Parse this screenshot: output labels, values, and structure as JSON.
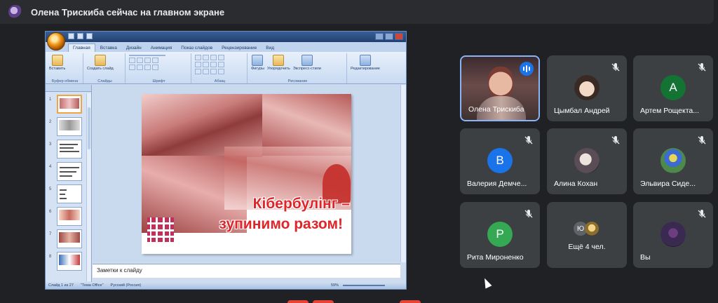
{
  "banner": {
    "text": "Олена Трискиба сейчас на главном экране"
  },
  "presentation": {
    "app_tabs": [
      "Главная",
      "Вставка",
      "Дизайн",
      "Анимация",
      "Показ слайдов",
      "Рецензирование",
      "Вид"
    ],
    "active_tab": "Главная",
    "ribbon_groups": {
      "clipboard": "Буфер обмена",
      "slides": "Слайды",
      "font": "Шрифт",
      "paragraph": "Абзац",
      "drawing": "Рисование",
      "editing": "Редактирование"
    },
    "ribbon_buttons": {
      "paste": "Вставить",
      "new_slide": "Создать слайд",
      "shapes": "Фигуры",
      "arrange": "Упорядочить",
      "quick_styles": "Экспресс-стили"
    },
    "thumbnails": [
      "1",
      "2",
      "3",
      "4",
      "5",
      "6",
      "7",
      "8"
    ],
    "slide": {
      "title_line1": "Кібербулінг –",
      "title_line2": "зупинимо разом!"
    },
    "notes_placeholder": "Заметки к слайду",
    "status": {
      "slide_counter": "Слайд 1 из 27",
      "theme": "\"Тема Office\"",
      "language": "Русский (Россия)",
      "zoom": "59%"
    }
  },
  "participants": [
    {
      "name": "Олена Трискиба",
      "type": "video",
      "speaking": true
    },
    {
      "name": "Цымбал Андрей",
      "type": "photo",
      "muted": true
    },
    {
      "name": "Артем Рощекта...",
      "type": "initial",
      "initial": "А",
      "color": "#137333",
      "muted": true
    },
    {
      "name": "Валерия Демче...",
      "type": "initial",
      "initial": "В",
      "color": "#1a73e8",
      "muted": true
    },
    {
      "name": "Алина Кохан",
      "type": "photo",
      "muted": true
    },
    {
      "name": "Эльвира Сиде...",
      "type": "photo",
      "muted": true
    },
    {
      "name": "Рита Мироненко",
      "type": "initial",
      "initial": "Р",
      "color": "#34a853",
      "muted": true
    },
    {
      "name": "Ещё 4 чел.",
      "type": "more",
      "initial": "Ю"
    },
    {
      "name": "Вы",
      "type": "photo",
      "muted": true
    }
  ]
}
